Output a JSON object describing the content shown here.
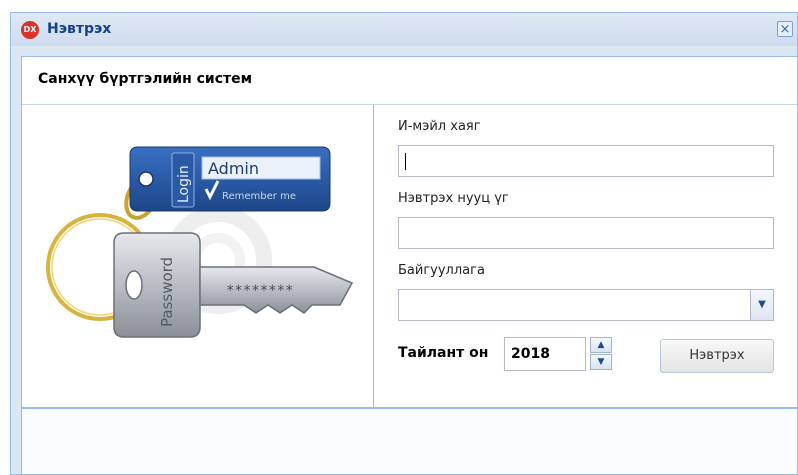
{
  "window": {
    "title": "Нэвтрэх",
    "app_icon_text": "DX",
    "close_glyph": "×"
  },
  "header": {
    "title": "Санхүү бүртгэлийн систем"
  },
  "illustration": {
    "tag_vertical_text": "Login",
    "tag_username": "Admin",
    "tag_remember": "Remember me",
    "key_vertical_text": "Password",
    "key_mask": "********"
  },
  "form": {
    "email_label": "И-мэйл хаяг",
    "email_value": "",
    "password_label": "Нэвтрэх нууц үг",
    "password_value": "",
    "org_label": "Байгууллага",
    "org_value": "",
    "year_label": "Тайлант он",
    "year_value": "2018",
    "login_button": "Нэвтрэх"
  },
  "colors": {
    "title_text": "#15428b",
    "border": "#99bbe8",
    "tag_blue": "#1f4c8f",
    "close_icon": "#3a6aa8"
  },
  "icons": [
    "app-logo-icon",
    "close-icon",
    "chevron-down-icon",
    "chevron-up-icon"
  ]
}
